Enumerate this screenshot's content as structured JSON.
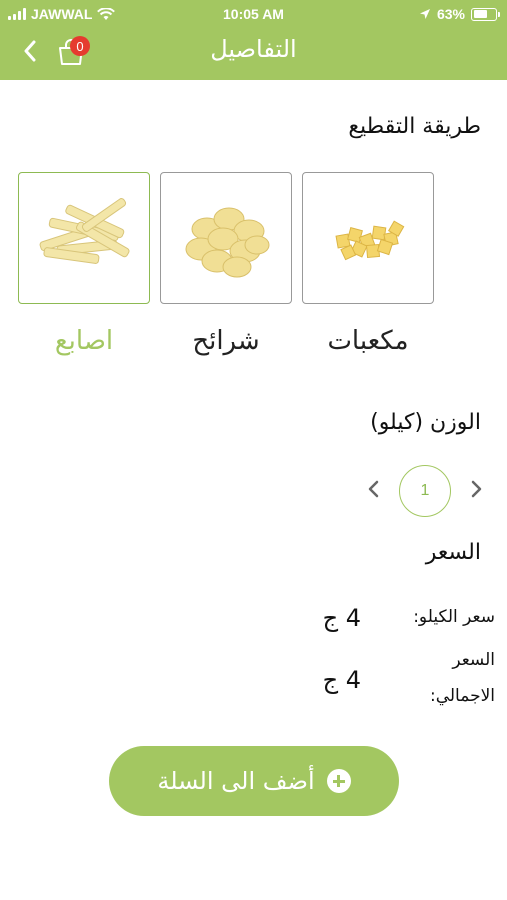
{
  "status_bar": {
    "carrier": "JAWWAL",
    "time": "10:05 AM",
    "battery": "63%"
  },
  "header": {
    "title": "التفاصيل",
    "cart_count": "0"
  },
  "cut_method": {
    "title": "طريقة التقطيع",
    "options": [
      {
        "label": "مكعبات",
        "image": "potato-cubes",
        "selected": false
      },
      {
        "label": "شرائح",
        "image": "potato-slices",
        "selected": false
      },
      {
        "label": "اصابع",
        "image": "potato-fingers",
        "selected": true
      }
    ]
  },
  "weight": {
    "title": "الوزن (كيلو)",
    "quantity": "1"
  },
  "price": {
    "title": "السعر",
    "per_kilo_label": "سعر الكيلو:",
    "per_kilo_value": "4 ج",
    "total_label_line1": "السعر",
    "total_label_line2": "الاجمالي:",
    "total_value": "4 ج"
  },
  "add_to_cart": {
    "label": "أضف الى السلة"
  },
  "colors": {
    "brand_green": "#a3c761",
    "badge_red": "#e53b2f"
  }
}
